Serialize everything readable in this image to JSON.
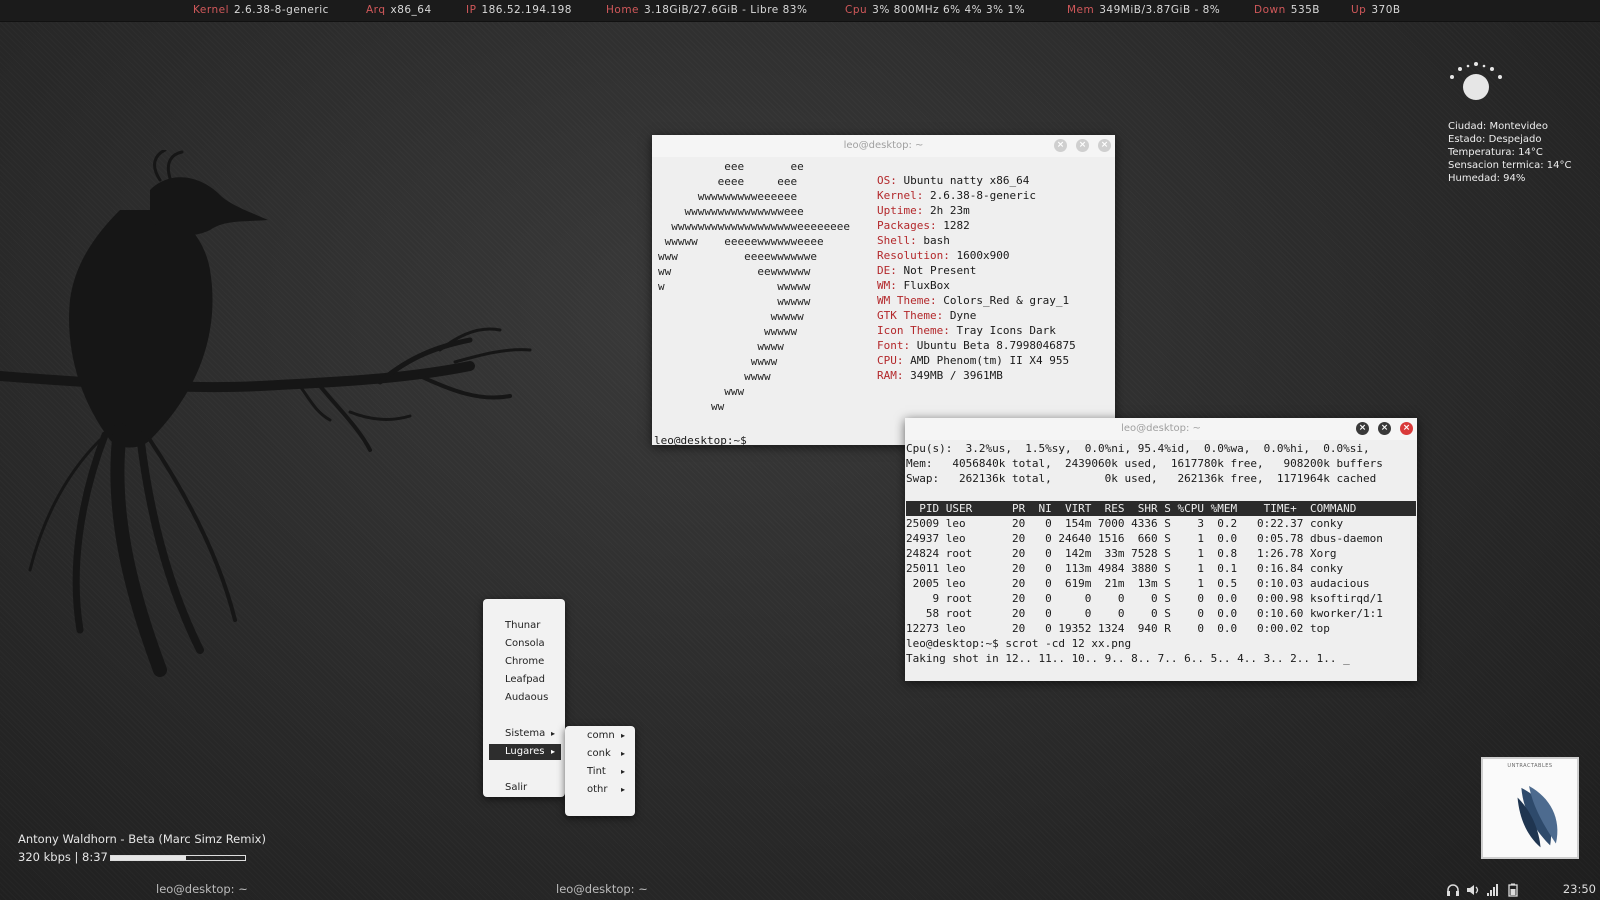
{
  "topbar": {
    "kernel_label": "Kernel",
    "kernel": "2.6.38-8-generic",
    "arq_label": "Arq",
    "arq": "x86_64",
    "ip_label": "IP",
    "ip": "186.52.194.198",
    "home_label": "Home",
    "home": "3.18GiB/27.6GiB - Libre 83%",
    "cpu_label": "Cpu",
    "cpu": "3%  800MHz 6% 4% 3% 1%",
    "mem_label": "Mem",
    "mem": "349MiB/3.87GiB - 8%",
    "down_label": "Down",
    "down": "535B",
    "up_label": "Up",
    "up": "370B"
  },
  "weather": {
    "icon": "sun-icon",
    "ciudad": "Ciudad: Montevideo",
    "estado": "Estado: Despejado",
    "temperatura": "Temperatura: 14°C",
    "sensacion": "Sensacion termica: 14°C",
    "humedad": "Humedad: 94%"
  },
  "win1": {
    "title": "leo@desktop: ~",
    "ascii": "          eee       ee\n         eeee     eee\n      wwwwwwwwweeeeee\n    wwwwwwwwwwwwwwweee\n  wwwwwwwwwwwwwwwwwwweeeeeeee\n wwwww    eeeeewwwwwweeee\nwww          eeeewwwwwwe\nww             eewwwwww\nw                 wwwww\n                  wwwww\n                 wwwww\n                wwwww\n               wwww\n              wwww\n             wwww\n          www\n        ww",
    "info": [
      {
        "label": "OS:",
        "value": " Ubuntu natty x86_64"
      },
      {
        "label": "Kernel:",
        "value": " 2.6.38-8-generic"
      },
      {
        "label": "Uptime:",
        "value": " 2h 23m"
      },
      {
        "label": "Packages:",
        "value": " 1282"
      },
      {
        "label": "Shell:",
        "value": " bash"
      },
      {
        "label": "Resolution:",
        "value": " 1600x900"
      },
      {
        "label": "DE:",
        "value": " Not Present"
      },
      {
        "label": "WM:",
        "value": " FluxBox"
      },
      {
        "label": "WM Theme:",
        "value": " Colors_Red & gray_1"
      },
      {
        "label": "GTK Theme:",
        "value": " Dyne"
      },
      {
        "label": "Icon Theme:",
        "value": " Tray Icons Dark"
      },
      {
        "label": "Font:",
        "value": " Ubuntu Beta 8.7998046875"
      },
      {
        "label": "CPU:",
        "value": " AMD Phenom(tm) II X4 955"
      },
      {
        "label": "RAM:",
        "value": " 349MB / 3961MB"
      }
    ],
    "prompt": "leo@desktop:~$ _"
  },
  "win2": {
    "title": "leo@desktop: ~",
    "summary": "Cpu(s):  3.2%us,  1.5%sy,  0.0%ni, 95.4%id,  0.0%wa,  0.0%hi,  0.0%si,\nMem:   4056840k total,  2439060k used,  1617780k free,   908200k buffers\nSwap:   262136k total,        0k used,   262136k free,  1171964k cached",
    "header": "  PID USER      PR  NI  VIRT  RES  SHR S %CPU %MEM    TIME+  COMMAND      ",
    "processes": "25009 leo       20   0  154m 7000 4336 S    3  0.2   0:22.37 conky\n24937 leo       20   0 24640 1516  660 S    1  0.0   0:05.78 dbus-daemon\n24824 root      20   0  142m  33m 7528 S    1  0.8   1:26.78 Xorg\n25011 leo       20   0  113m 4984 3880 S    1  0.1   0:16.84 conky\n 2005 leo       20   0  619m  21m  13m S    1  0.5   0:10.03 audacious\n    9 root      20   0     0    0    0 S    0  0.0   0:00.98 ksoftirqd/1\n   58 root      20   0     0    0    0 S    0  0.0   0:10.60 kworker/1:1\n12273 leo       20   0 19352 1324  940 R    0  0.0   0:00.02 top",
    "command": "leo@desktop:~$ scrot -cd 12 xx.png\nTaking shot in 12.. 11.. 10.. 9.. 8.. 7.. 6.. 5.. 4.. 3.. 2.. 1.. _"
  },
  "menu": {
    "items": [
      "Thunar",
      "Consola",
      "Chrome",
      "Leafpad",
      "Audaous"
    ],
    "sistema": "Sistema",
    "lugares": "Lugares",
    "salir": "Salir",
    "submenu": [
      "comn",
      "conk",
      "Tint",
      "othr"
    ]
  },
  "player": {
    "title": "Antony Waldhorn - Beta (Marc Simz Remix)",
    "bitrate": "320 kbps | 8:37",
    "progress": 0.56
  },
  "taskbar": {
    "task1": "leo@desktop: ~",
    "task2": "leo@desktop: ~",
    "tray_icons": [
      "headphones-icon",
      "volume-icon",
      "signal-icon",
      "battery-icon"
    ],
    "clock": "23:50"
  },
  "album": {
    "caption": "UNTRACTABLES"
  },
  "colors": {
    "accent_red": "#d0585a",
    "sysinfo_red": "#b3282b",
    "close_red": "#d93a3a",
    "titlebar_btn": "#3a3a3a"
  }
}
